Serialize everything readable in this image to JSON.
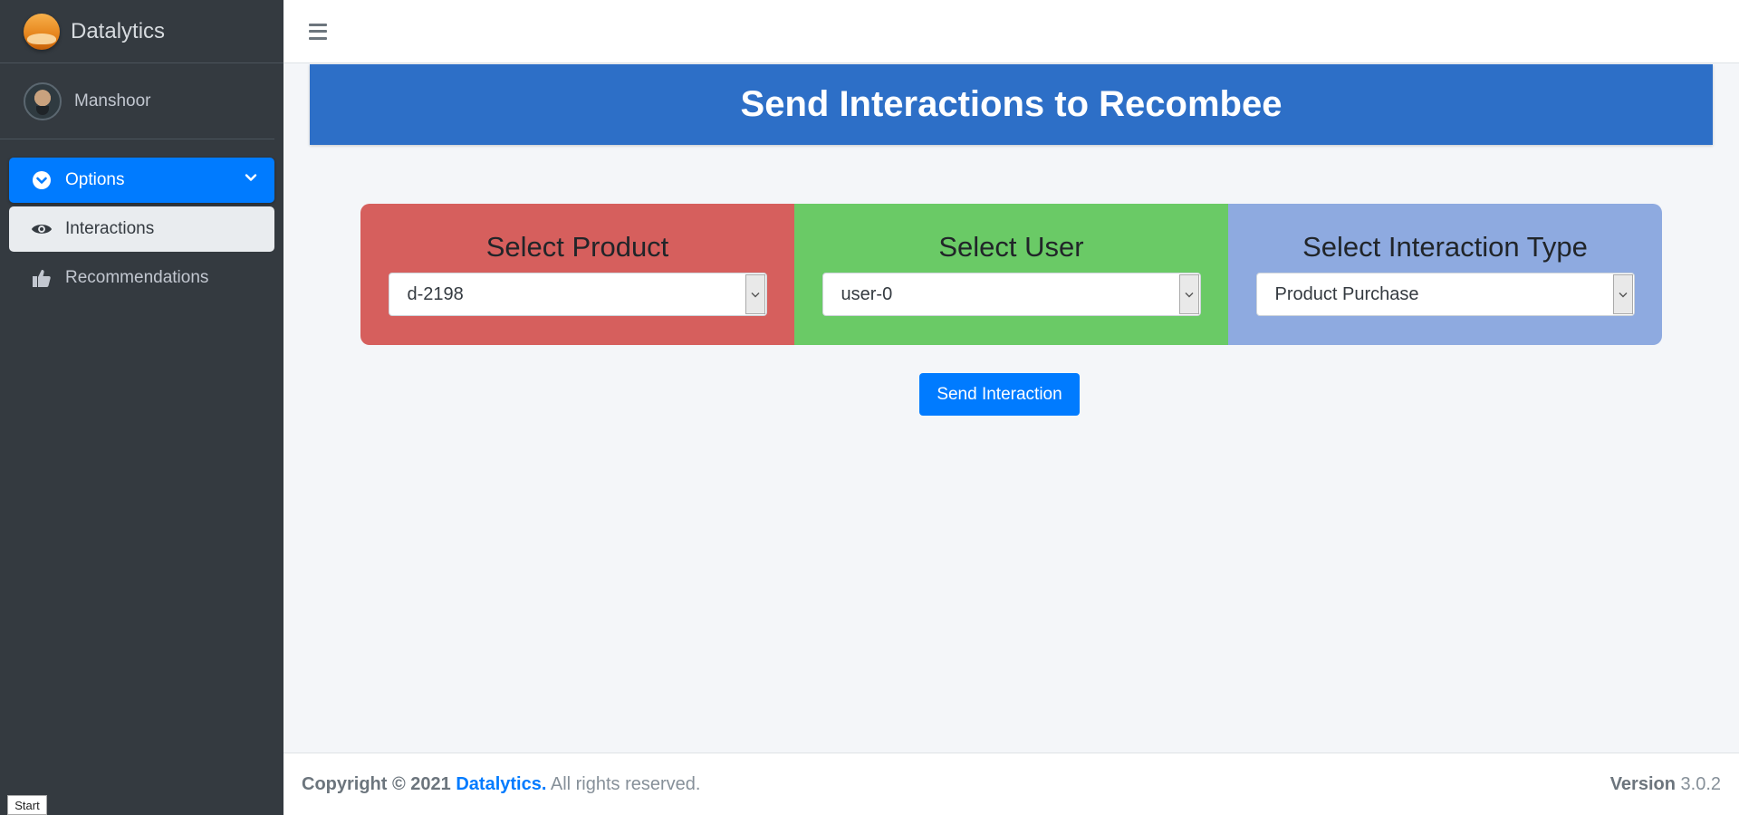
{
  "brand": {
    "name": "Datalytics"
  },
  "user": {
    "name": "Manshoor"
  },
  "sidebar": {
    "items": [
      {
        "label": "Options",
        "icon": "chevron-circle-icon",
        "state": "active"
      },
      {
        "label": "Interactions",
        "icon": "eye-icon",
        "state": "selected"
      },
      {
        "label": "Recommendations",
        "icon": "thumbs-up-icon",
        "state": "normal"
      }
    ]
  },
  "page": {
    "title": "Send Interactions to Recombee"
  },
  "selectors": [
    {
      "title": "Select Product",
      "value": "d-2198",
      "color": "#d65f5d"
    },
    {
      "title": "Select User",
      "value": "user-0",
      "color": "#6aca66"
    },
    {
      "title": "Select Interaction Type",
      "value": "Product Purchase",
      "color": "#8eaae0"
    }
  ],
  "actions": {
    "send_label": "Send Interaction"
  },
  "footer": {
    "copyright_prefix": "Copyright © 2021",
    "brand_link": "Datalytics.",
    "copyright_suffix": "All rights reserved.",
    "version_label": "Version",
    "version_number": "3.0.2"
  },
  "taskbar": {
    "start_label": "Start"
  },
  "colors": {
    "accent": "#007bff",
    "sidebar_bg": "#343a40",
    "banner": "#2d6fc7"
  }
}
